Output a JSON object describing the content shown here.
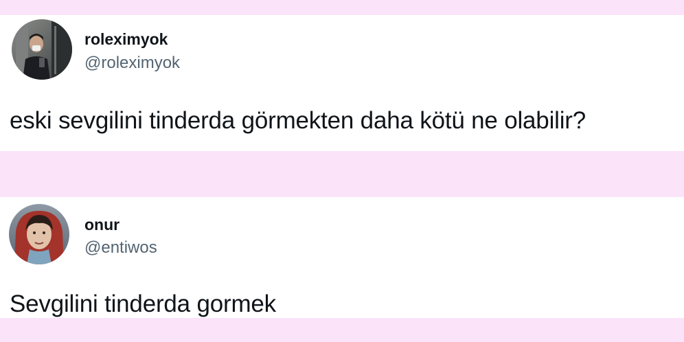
{
  "tweets": [
    {
      "display_name": "roleximyok",
      "handle": "@roleximyok",
      "text": "eski sevgilini tinderda görmekten daha kötü ne olabilir?"
    },
    {
      "display_name": "onur",
      "handle": "@entiwos",
      "text": "Sevgilini tinderda gormek"
    }
  ],
  "colors": {
    "background": "#fbe3fa",
    "card": "#ffffff",
    "name": "#0f1419",
    "handle": "#536471"
  }
}
